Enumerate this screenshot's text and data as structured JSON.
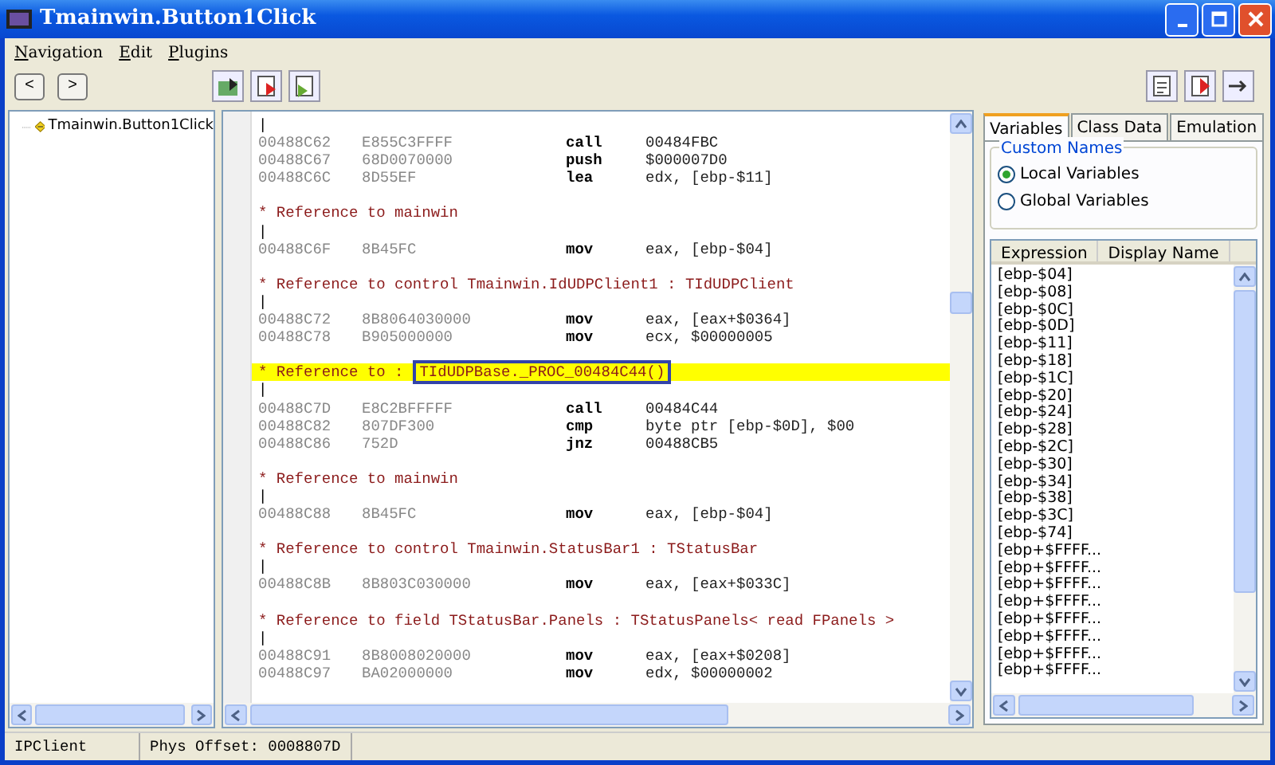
{
  "window": {
    "title": "Tmainwin.Button1Click"
  },
  "menu": [
    "Navigation",
    "Edit",
    "Plugins"
  ],
  "nav_buttons": [
    "<",
    ">"
  ],
  "tree": {
    "items": [
      {
        "label": "Tmainwin.Button1Click"
      }
    ]
  },
  "code": {
    "lines": [
      {
        "kind": "bar",
        "text": "|"
      },
      {
        "kind": "instr",
        "addr": "00488C62",
        "bytes": "E855C3FFFF",
        "op": "call",
        "args": "00484FBC"
      },
      {
        "kind": "instr",
        "addr": "00488C67",
        "bytes": "68D0070000",
        "op": "push",
        "args": "$000007D0"
      },
      {
        "kind": "instr",
        "addr": "00488C6C",
        "bytes": "8D55EF",
        "op": "lea",
        "args": "edx, [ebp-$11]"
      },
      {
        "kind": "blank"
      },
      {
        "kind": "ref",
        "text": "* Reference to mainwin",
        "selected": false
      },
      {
        "kind": "bar",
        "text": "|"
      },
      {
        "kind": "instr",
        "addr": "00488C6F",
        "bytes": "8B45FC",
        "op": "mov",
        "args": "eax, [ebp-$04]"
      },
      {
        "kind": "blank"
      },
      {
        "kind": "ref",
        "text": "* Reference to control Tmainwin.IdUDPClient1 : TIdUDPClient",
        "selected": false
      },
      {
        "kind": "bar",
        "text": "|"
      },
      {
        "kind": "instr",
        "addr": "00488C72",
        "bytes": "8B8064030000",
        "op": "mov",
        "args": "eax, [eax+$0364]"
      },
      {
        "kind": "instr",
        "addr": "00488C78",
        "bytes": "B905000000",
        "op": "mov",
        "args": "ecx, $00000005"
      },
      {
        "kind": "blank"
      },
      {
        "kind": "ref",
        "text": "* Reference to :",
        "boxed": "TIdUDPBase._PROC_00484C44()",
        "selected": true
      },
      {
        "kind": "bar",
        "text": "|"
      },
      {
        "kind": "instr",
        "addr": "00488C7D",
        "bytes": "E8C2BFFFFF",
        "op": "call",
        "args": "00484C44"
      },
      {
        "kind": "instr",
        "addr": "00488C82",
        "bytes": "807DF300",
        "op": "cmp",
        "args": "byte ptr [ebp-$0D], $00"
      },
      {
        "kind": "instr",
        "addr": "00488C86",
        "bytes": "752D",
        "op": "jnz",
        "args": "00488CB5"
      },
      {
        "kind": "blank"
      },
      {
        "kind": "ref",
        "text": "* Reference to mainwin",
        "selected": false
      },
      {
        "kind": "bar",
        "text": "|"
      },
      {
        "kind": "instr",
        "addr": "00488C88",
        "bytes": "8B45FC",
        "op": "mov",
        "args": "eax, [ebp-$04]"
      },
      {
        "kind": "blank"
      },
      {
        "kind": "ref",
        "text": "* Reference to control Tmainwin.StatusBar1 : TStatusBar",
        "selected": false
      },
      {
        "kind": "bar",
        "text": "|"
      },
      {
        "kind": "instr",
        "addr": "00488C8B",
        "bytes": "8B803C030000",
        "op": "mov",
        "args": "eax, [eax+$033C]"
      },
      {
        "kind": "blank"
      },
      {
        "kind": "ref",
        "text": "* Reference to field TStatusBar.Panels : TStatusPanels< read FPanels >",
        "selected": false
      },
      {
        "kind": "bar",
        "text": "|"
      },
      {
        "kind": "instr",
        "addr": "00488C91",
        "bytes": "8B8008020000",
        "op": "mov",
        "args": "eax, [eax+$0208]"
      },
      {
        "kind": "instr",
        "addr": "00488C97",
        "bytes": "BA02000000",
        "op": "mov",
        "args": "edx, $00000002"
      }
    ]
  },
  "side_panel": {
    "tabs": [
      {
        "label": "Variables",
        "selected": true
      },
      {
        "label": "Class Data",
        "selected": false
      },
      {
        "label": "Emulation",
        "selected": false
      }
    ],
    "group": {
      "title": "Custom Names",
      "options": [
        {
          "label": "Local Variables",
          "selected": true
        },
        {
          "label": "Global Variables",
          "selected": false
        }
      ]
    },
    "columns": [
      "Expression",
      "Display Name"
    ],
    "rows": [
      "[ebp-$04]",
      "[ebp-$08]",
      "[ebp-$0C]",
      "[ebp-$0D]",
      "[ebp-$11]",
      "[ebp-$18]",
      "[ebp-$1C]",
      "[ebp-$20]",
      "[ebp-$24]",
      "[ebp-$28]",
      "[ebp-$2C]",
      "[ebp-$30]",
      "[ebp-$34]",
      "[ebp-$38]",
      "[ebp-$3C]",
      "[ebp-$74]",
      "[ebp+$FFFF...",
      "[ebp+$FFFF...",
      "[ebp+$FFFF...",
      "[ebp+$FFFF...",
      "[ebp+$FFFF...",
      "[ebp+$FFFF...",
      "[ebp+$FFFF...",
      "[ebp+$FFFF..."
    ]
  },
  "status_bar": [
    "IPClient",
    "Phys Offset: 0008807D"
  ]
}
